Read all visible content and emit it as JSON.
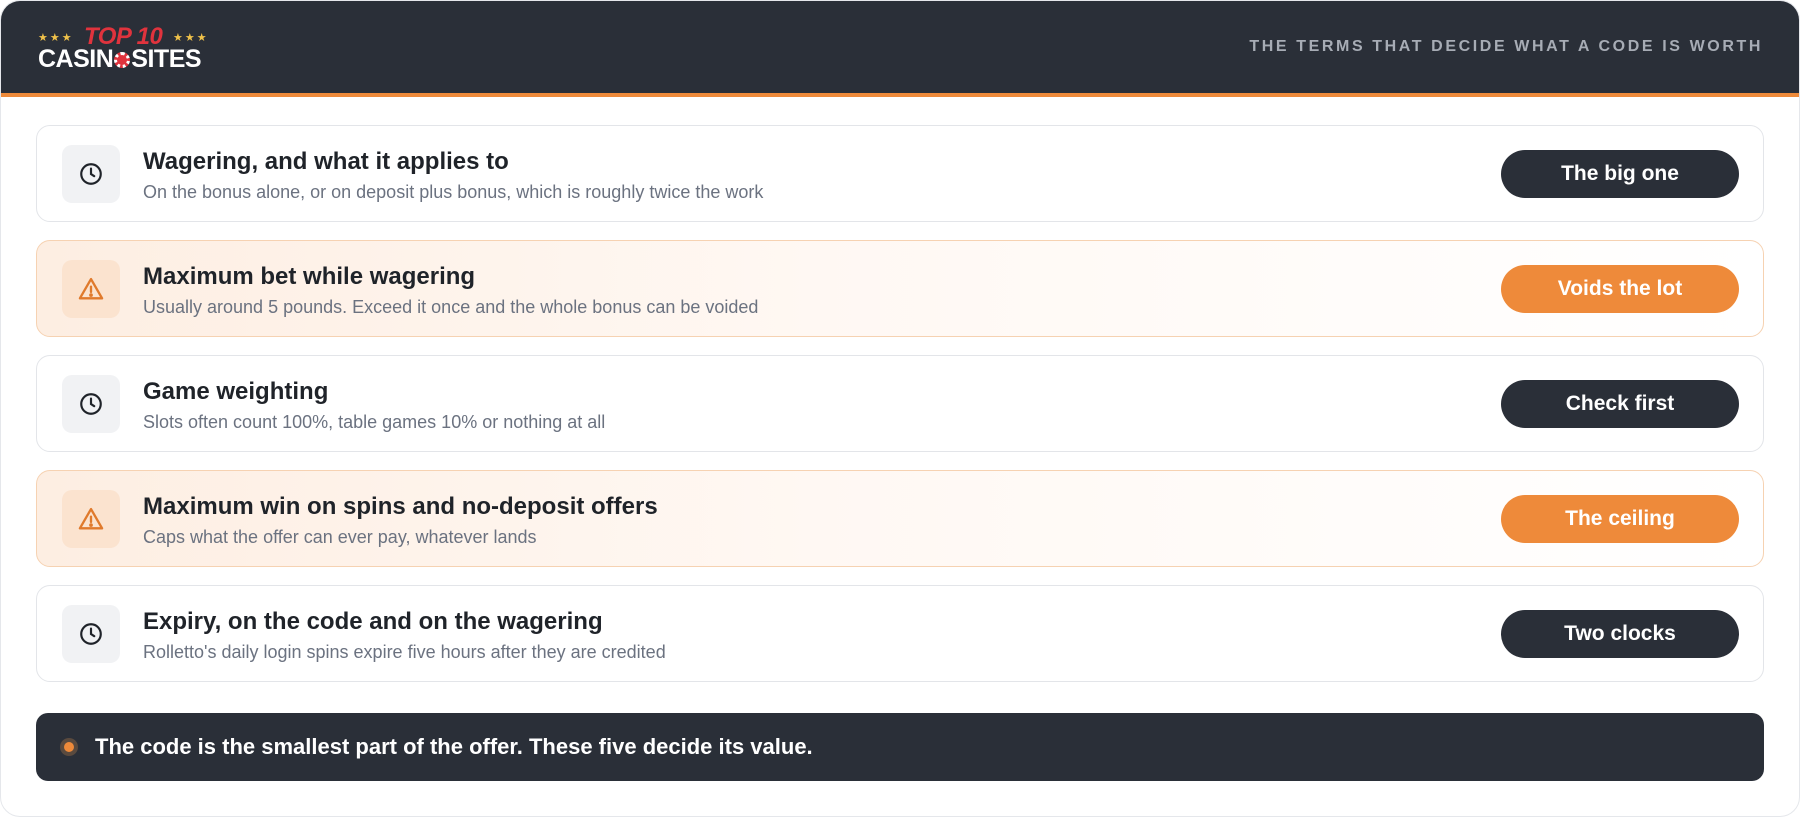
{
  "header": {
    "logo": {
      "stars_left": "★★★",
      "top_text": "TOP 10",
      "stars_right": "★★★",
      "bottom_left": "CASIN",
      "bottom_right": "SITES"
    },
    "tagline": "THE TERMS THAT DECIDE WHAT A CODE IS WORTH"
  },
  "colors": {
    "header_bg": "#2a2f38",
    "accent": "#ee8a3a",
    "logo_red": "#e0333d"
  },
  "terms": [
    {
      "icon": "clock-icon",
      "highlight": false,
      "title": "Wagering, and what it applies to",
      "subtitle": "On the bonus alone, or on deposit plus bonus, which is roughly twice the work",
      "badge": "The big one"
    },
    {
      "icon": "warning-icon",
      "highlight": true,
      "title": "Maximum bet while wagering",
      "subtitle": "Usually around 5 pounds. Exceed it once and the whole bonus can be voided",
      "badge": "Voids the lot"
    },
    {
      "icon": "clock-icon",
      "highlight": false,
      "title": "Game weighting",
      "subtitle": "Slots often count 100%, table games 10% or nothing at all",
      "badge": "Check first"
    },
    {
      "icon": "warning-icon",
      "highlight": true,
      "title": "Maximum win on spins and no-deposit offers",
      "subtitle": "Caps what the offer can ever pay, whatever lands",
      "badge": "The ceiling"
    },
    {
      "icon": "clock-icon",
      "highlight": false,
      "title": "Expiry, on the code and on the wagering",
      "subtitle": "Rolletto's daily login spins expire five hours after they are credited",
      "badge": "Two clocks"
    }
  ],
  "footer": {
    "text": "The code is the smallest part of the offer. These five decide its value."
  }
}
